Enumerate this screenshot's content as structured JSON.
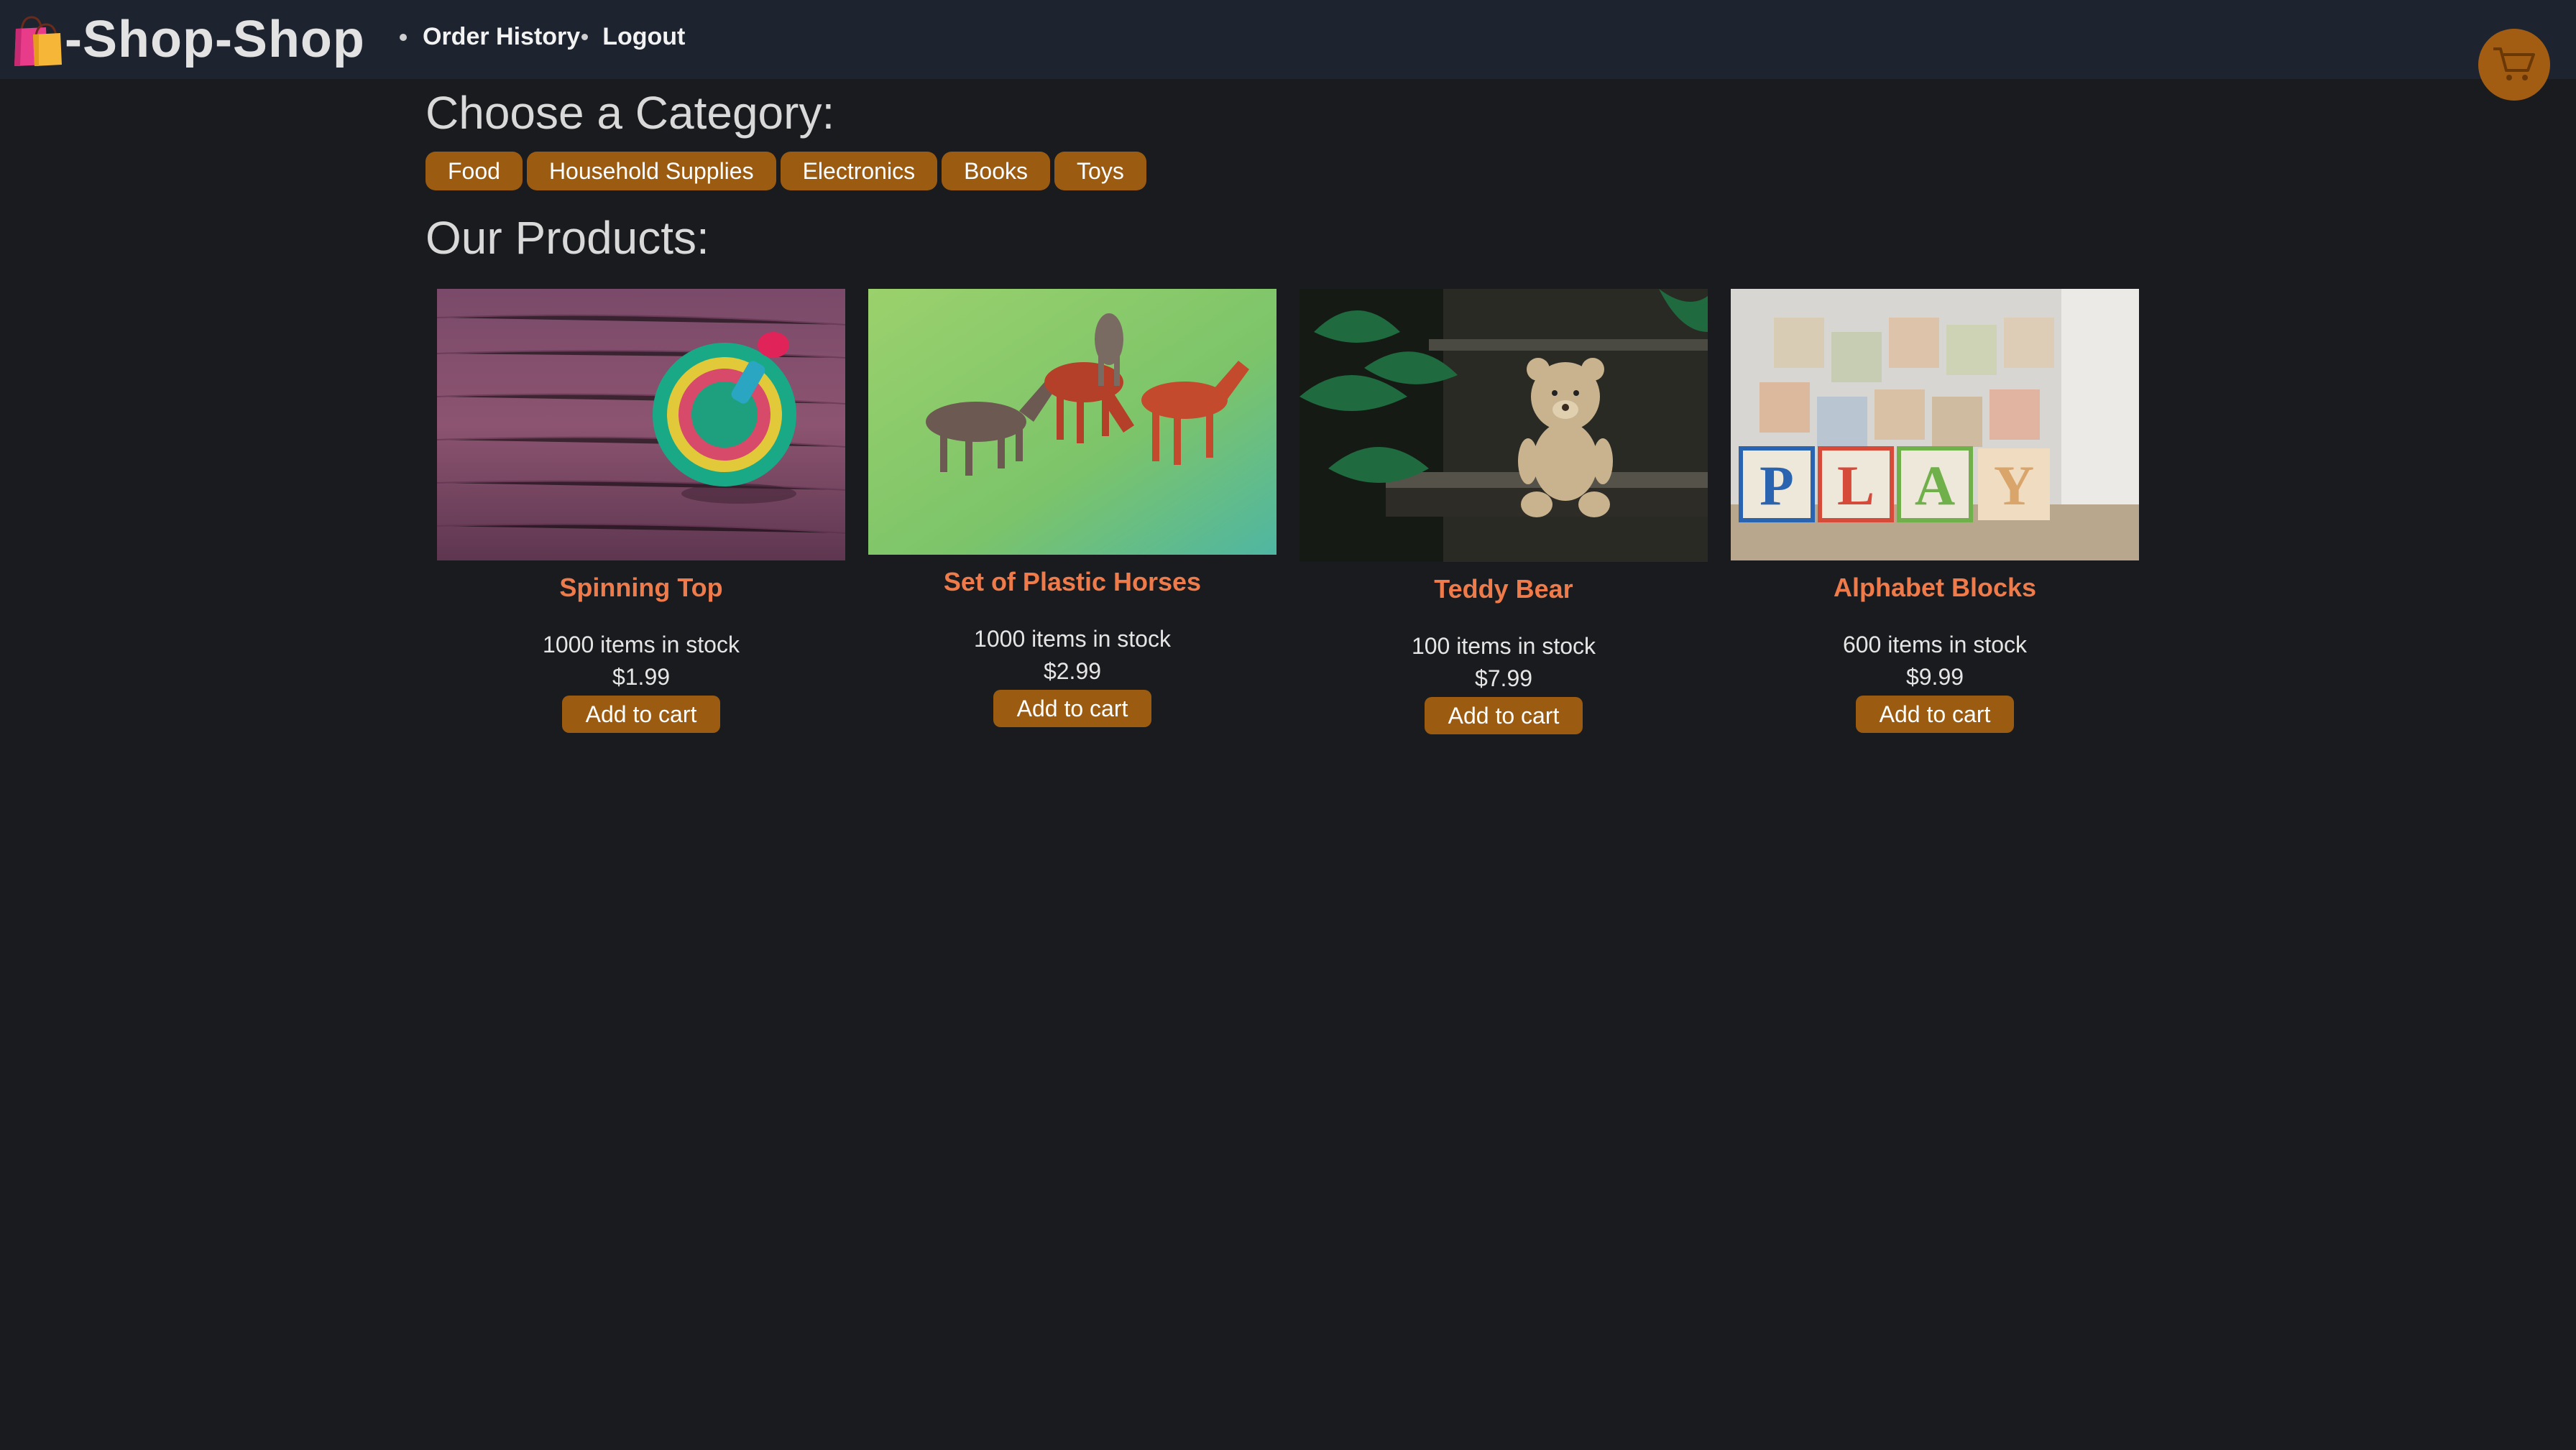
{
  "header": {
    "brand": "-Shop-Shop",
    "brand_icon": "shopping-bags-icon",
    "nav": [
      {
        "label": "Order History"
      },
      {
        "label": "Logout"
      }
    ],
    "cart_icon": "cart-icon"
  },
  "categories": {
    "title": "Choose a Category:",
    "items": [
      "Food",
      "Household Supplies",
      "Electronics",
      "Books",
      "Toys"
    ]
  },
  "products": {
    "title": "Our Products:",
    "items": [
      {
        "name": "Spinning Top",
        "stock": "1000 items in stock",
        "price": "$1.99",
        "button": "Add to cart",
        "image": "spinning-top-photo"
      },
      {
        "name": "Set of Plastic Horses",
        "stock": "1000 items in stock",
        "price": "$2.99",
        "button": "Add to cart",
        "image": "plastic-horses-photo"
      },
      {
        "name": "Teddy Bear",
        "stock": "100 items in stock",
        "price": "$7.99",
        "button": "Add to cart",
        "image": "teddy-bear-photo"
      },
      {
        "name": "Alphabet Blocks",
        "stock": "600 items in stock",
        "price": "$9.99",
        "button": "Add to cart",
        "image": "alphabet-blocks-photo",
        "image_text": "PLAY"
      }
    ]
  },
  "colors": {
    "background": "#1a1b1e",
    "header": "#1d2430",
    "accent": "#9b5b10",
    "product_name": "#ef7a4a"
  }
}
